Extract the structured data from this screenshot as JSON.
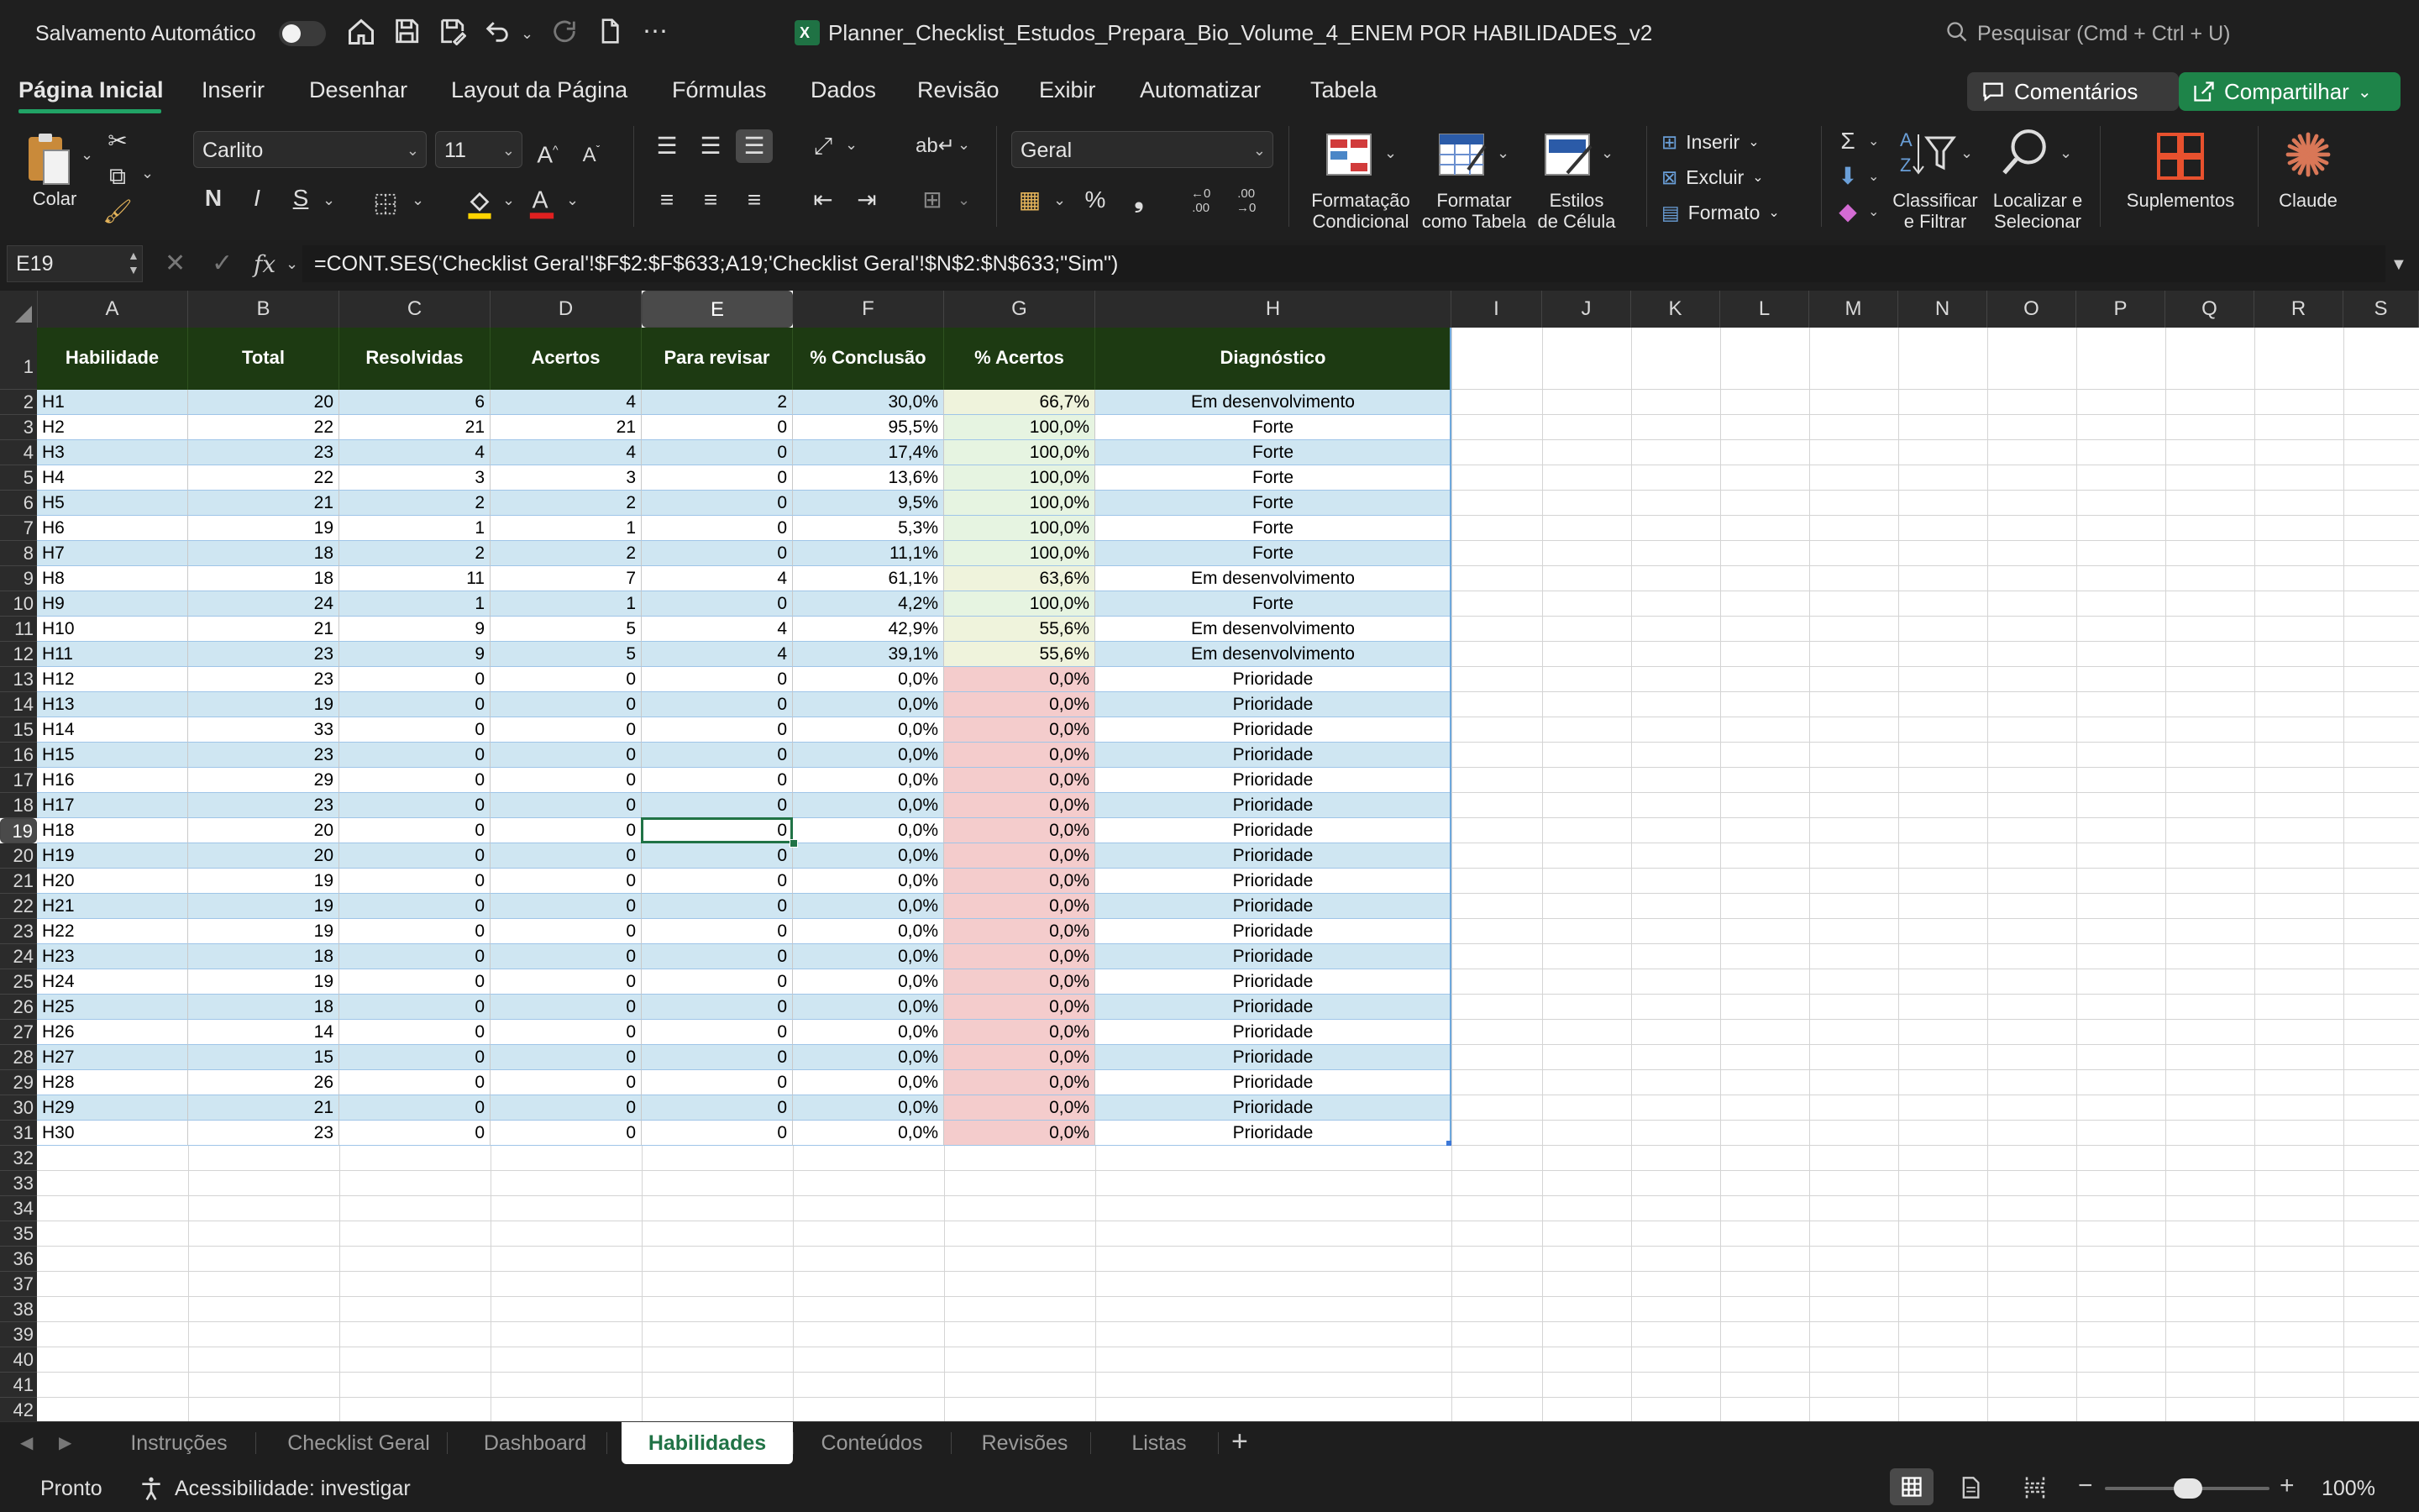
{
  "titlebar": {
    "autosave_label": "Salvamento Automático",
    "filename": "Planner_Checklist_Estudos_Prepara_Bio_Volume_4_ENEM POR HABILIDADES_v2",
    "search_placeholder": "Pesquisar (Cmd + Ctrl + U)"
  },
  "ribbon_tabs": [
    "Página Inicial",
    "Inserir",
    "Desenhar",
    "Layout da Página",
    "Fórmulas",
    "Dados",
    "Revisão",
    "Exibir",
    "Automatizar",
    "Tabela"
  ],
  "buttons": {
    "comments": "Comentários",
    "share": "Compartilhar"
  },
  "ribbon": {
    "paste": "Colar",
    "font_name": "Carlito",
    "font_size": "11",
    "bold": "N",
    "italic": "I",
    "underline": "S",
    "number_format": "Geral",
    "percent": "%",
    "comma": "❟",
    "dec_inc": "←0\n.00",
    "dec_dec": ".00\n→0",
    "cond_format": "Formatação\nCondicional",
    "format_table": "Formatar\ncomo Tabela",
    "cell_styles": "Estilos\nde Célula",
    "insert": "Inserir",
    "delete": "Excluir",
    "format": "Formato",
    "sort_filter": "Classificar\ne Filtrar",
    "find_select": "Localizar e\nSelecionar",
    "addins": "Suplementos",
    "claude": "Claude"
  },
  "formula_bar": {
    "namebox": "E19",
    "fx": "fx",
    "formula": "=CONT.SES('Checklist Geral'!$F$2:$F$633;A19;'Checklist Geral'!$N$2:$N$633;\"Sim\")"
  },
  "columns": [
    "A",
    "B",
    "C",
    "D",
    "E",
    "F",
    "G",
    "H",
    "I",
    "J",
    "K",
    "L",
    "M",
    "N",
    "O",
    "P",
    "Q",
    "R",
    "S"
  ],
  "table_headers": [
    "Habilidade",
    "Total",
    "Resolvidas",
    "Acertos",
    "Para revisar",
    "% Conclusão",
    "% Acertos",
    "Diagnóstico"
  ],
  "rows": [
    [
      "H1",
      "20",
      "6",
      "4",
      "2",
      "30,0%",
      "66,7%",
      "Em desenvolvimento"
    ],
    [
      "H2",
      "22",
      "21",
      "21",
      "0",
      "95,5%",
      "100,0%",
      "Forte"
    ],
    [
      "H3",
      "23",
      "4",
      "4",
      "0",
      "17,4%",
      "100,0%",
      "Forte"
    ],
    [
      "H4",
      "22",
      "3",
      "3",
      "0",
      "13,6%",
      "100,0%",
      "Forte"
    ],
    [
      "H5",
      "21",
      "2",
      "2",
      "0",
      "9,5%",
      "100,0%",
      "Forte"
    ],
    [
      "H6",
      "19",
      "1",
      "1",
      "0",
      "5,3%",
      "100,0%",
      "Forte"
    ],
    [
      "H7",
      "18",
      "2",
      "2",
      "0",
      "11,1%",
      "100,0%",
      "Forte"
    ],
    [
      "H8",
      "18",
      "11",
      "7",
      "4",
      "61,1%",
      "63,6%",
      "Em desenvolvimento"
    ],
    [
      "H9",
      "24",
      "1",
      "1",
      "0",
      "4,2%",
      "100,0%",
      "Forte"
    ],
    [
      "H10",
      "21",
      "9",
      "5",
      "4",
      "42,9%",
      "55,6%",
      "Em desenvolvimento"
    ],
    [
      "H11",
      "23",
      "9",
      "5",
      "4",
      "39,1%",
      "55,6%",
      "Em desenvolvimento"
    ],
    [
      "H12",
      "23",
      "0",
      "0",
      "0",
      "0,0%",
      "0,0%",
      "Prioridade"
    ],
    [
      "H13",
      "19",
      "0",
      "0",
      "0",
      "0,0%",
      "0,0%",
      "Prioridade"
    ],
    [
      "H14",
      "33",
      "0",
      "0",
      "0",
      "0,0%",
      "0,0%",
      "Prioridade"
    ],
    [
      "H15",
      "23",
      "0",
      "0",
      "0",
      "0,0%",
      "0,0%",
      "Prioridade"
    ],
    [
      "H16",
      "29",
      "0",
      "0",
      "0",
      "0,0%",
      "0,0%",
      "Prioridade"
    ],
    [
      "H17",
      "23",
      "0",
      "0",
      "0",
      "0,0%",
      "0,0%",
      "Prioridade"
    ],
    [
      "H18",
      "20",
      "0",
      "0",
      "0",
      "0,0%",
      "0,0%",
      "Prioridade"
    ],
    [
      "H19",
      "20",
      "0",
      "0",
      "0",
      "0,0%",
      "0,0%",
      "Prioridade"
    ],
    [
      "H20",
      "19",
      "0",
      "0",
      "0",
      "0,0%",
      "0,0%",
      "Prioridade"
    ],
    [
      "H21",
      "19",
      "0",
      "0",
      "0",
      "0,0%",
      "0,0%",
      "Prioridade"
    ],
    [
      "H22",
      "19",
      "0",
      "0",
      "0",
      "0,0%",
      "0,0%",
      "Prioridade"
    ],
    [
      "H23",
      "18",
      "0",
      "0",
      "0",
      "0,0%",
      "0,0%",
      "Prioridade"
    ],
    [
      "H24",
      "19",
      "0",
      "0",
      "0",
      "0,0%",
      "0,0%",
      "Prioridade"
    ],
    [
      "H25",
      "18",
      "0",
      "0",
      "0",
      "0,0%",
      "0,0%",
      "Prioridade"
    ],
    [
      "H26",
      "14",
      "0",
      "0",
      "0",
      "0,0%",
      "0,0%",
      "Prioridade"
    ],
    [
      "H27",
      "15",
      "0",
      "0",
      "0",
      "0,0%",
      "0,0%",
      "Prioridade"
    ],
    [
      "H28",
      "26",
      "0",
      "0",
      "0",
      "0,0%",
      "0,0%",
      "Prioridade"
    ],
    [
      "H29",
      "21",
      "0",
      "0",
      "0",
      "0,0%",
      "0,0%",
      "Prioridade"
    ],
    [
      "H30",
      "23",
      "0",
      "0",
      "0",
      "0,0%",
      "0,0%",
      "Prioridade"
    ]
  ],
  "row_numbers": [
    "1",
    "2",
    "3",
    "4",
    "5",
    "6",
    "7",
    "8",
    "9",
    "10",
    "11",
    "12",
    "13",
    "14",
    "15",
    "16",
    "17",
    "18",
    "19",
    "20",
    "21",
    "22",
    "23",
    "24",
    "25",
    "26",
    "27",
    "28",
    "29",
    "30",
    "31",
    "32",
    "33",
    "34",
    "35",
    "36",
    "37",
    "38",
    "39",
    "40",
    "41",
    "42"
  ],
  "selected_cell": {
    "row": 19,
    "col": "E"
  },
  "colors": {
    "header_bg": "#1d3a12",
    "band": "#cfe6f2",
    "white": "#ffffff",
    "acertos_green": "#e6f4e1",
    "acertos_yellow": "#eff3dc",
    "acertos_red": "#f4cccc",
    "accent": "#21a366"
  },
  "sheet_tabs": [
    "Instruções",
    "Checklist Geral",
    "Dashboard",
    "Habilidades",
    "Conteúdos",
    "Revisões",
    "Listas"
  ],
  "active_sheet": "Habilidades",
  "status": {
    "ready": "Pronto",
    "accessibility": "Acessibilidade: investigar",
    "zoom": "100%"
  }
}
